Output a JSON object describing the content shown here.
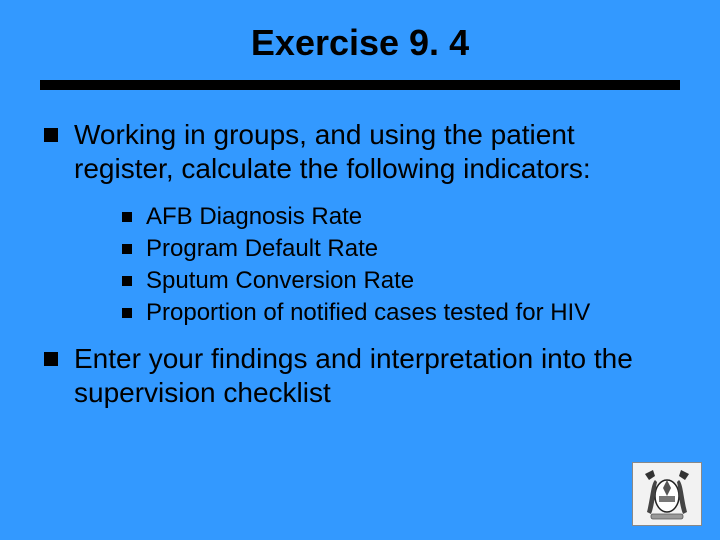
{
  "title": "Exercise 9. 4",
  "bullets": [
    {
      "text": "Working in groups, and using the patient register, calculate the following indicators:",
      "sub": [
        "AFB Diagnosis Rate",
        "Program Default Rate",
        "Sputum Conversion Rate",
        "Proportion of notified cases tested for HIV"
      ]
    },
    {
      "text": "Enter your findings and interpretation into the supervision checklist"
    }
  ]
}
